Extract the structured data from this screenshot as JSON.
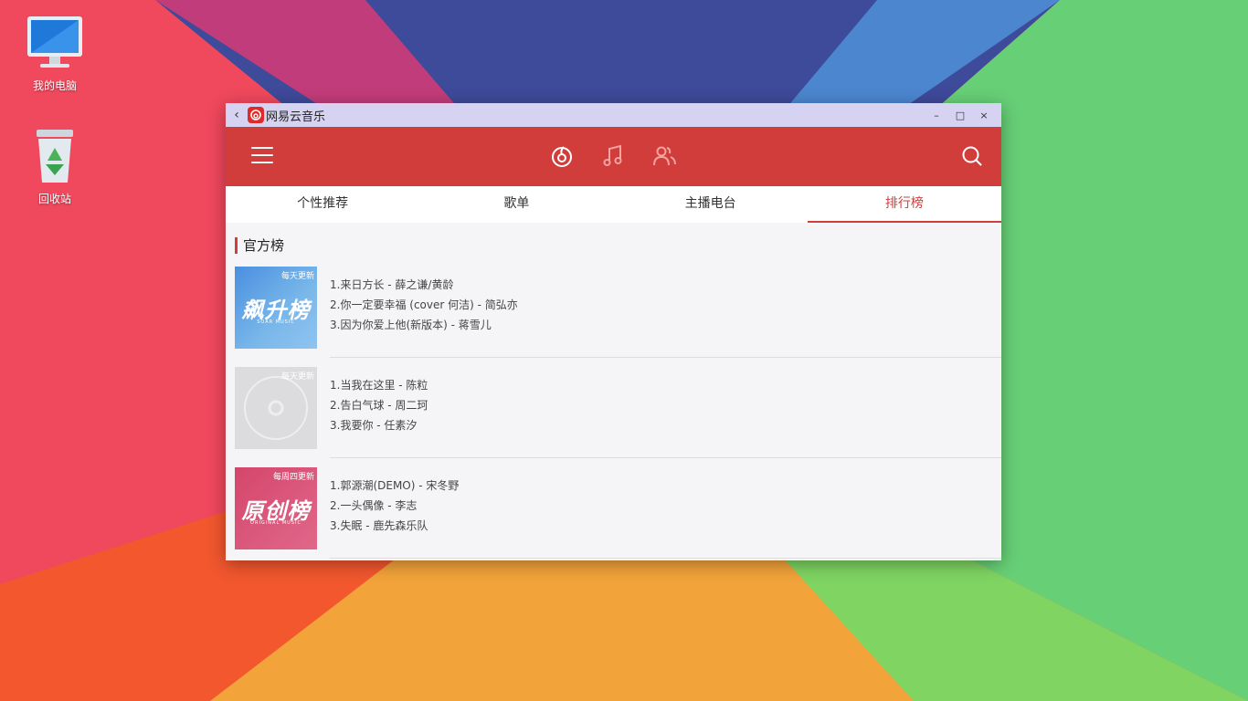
{
  "desktop": {
    "icons": [
      {
        "label": "我的电脑"
      },
      {
        "label": "回收站"
      }
    ]
  },
  "window": {
    "title": "网易云音乐",
    "back_glyph": "‹",
    "controls": {
      "minimize": "–",
      "maximize": "□",
      "close": "×"
    },
    "colors": {
      "header": "#d13d3a",
      "titlebar": "#d6d3f2",
      "accent": "#d13d3a"
    }
  },
  "header": {
    "icons": [
      "menu-icon",
      "discover-icon",
      "music-note-icon",
      "friends-icon",
      "search-icon"
    ]
  },
  "tabs": [
    {
      "label": "个性推荐",
      "active": false
    },
    {
      "label": "歌单",
      "active": false
    },
    {
      "label": "主播电台",
      "active": false
    },
    {
      "label": "排行榜",
      "active": true
    }
  ],
  "section": {
    "title": "官方榜"
  },
  "ranks": [
    {
      "cover_badge": "每天更新",
      "cover_title": "飙升榜",
      "cover_sub": "SOAR MUSIC",
      "tracks": [
        "1.来日方长 - 薛之谦/黄龄",
        "2.你一定要幸福 (cover 何洁) - 简弘亦",
        "3.因为你爱上他(新版本) - 蒋雪儿"
      ]
    },
    {
      "cover_badge": "每天更新",
      "cover_title": "",
      "cover_sub": "",
      "tracks": [
        "1.当我在这里 - 陈粒",
        "2.告白气球 - 周二珂",
        "3.我要你 - 任素汐"
      ]
    },
    {
      "cover_badge": "每周四更新",
      "cover_title": "原创榜",
      "cover_sub": "ORIGINAL MUSIC",
      "tracks": [
        "1.郭源潮(DEMO) - 宋冬野",
        "2.一头偶像 - 李志",
        "3.失眠 - 鹿先森乐队"
      ]
    }
  ]
}
